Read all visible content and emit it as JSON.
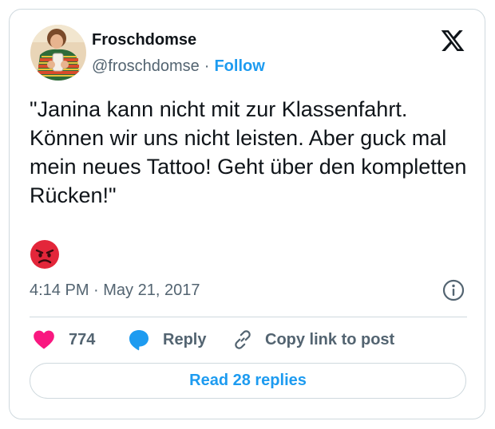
{
  "tweet": {
    "author": {
      "display_name": "Froschdomse",
      "handle": "@froschdomse",
      "separator": "·",
      "follow_label": "Follow",
      "avatar_icon": "profile-photo-avatar"
    },
    "brand_logo": "x-logo-icon",
    "text": "\"Janina kann nicht mit zur Klassenfahrt. Können wir uns nicht leisten. Aber guck mal mein neues Tattoo! Geht über den kompletten Rücken!\"",
    "emoji": "angry-face-emoji",
    "timestamp": "4:14 PM · May 21, 2017",
    "info_icon": "info-icon",
    "actions": {
      "like_count": "774",
      "reply_label": "Reply",
      "copy_link_label": "Copy link to post"
    },
    "read_replies_label": "Read 28 replies"
  },
  "colors": {
    "accent": "#1d9bf0",
    "like": "#f91880",
    "secondary_text": "#536471",
    "border": "#cfd9de",
    "primary_text": "#0f1419"
  }
}
